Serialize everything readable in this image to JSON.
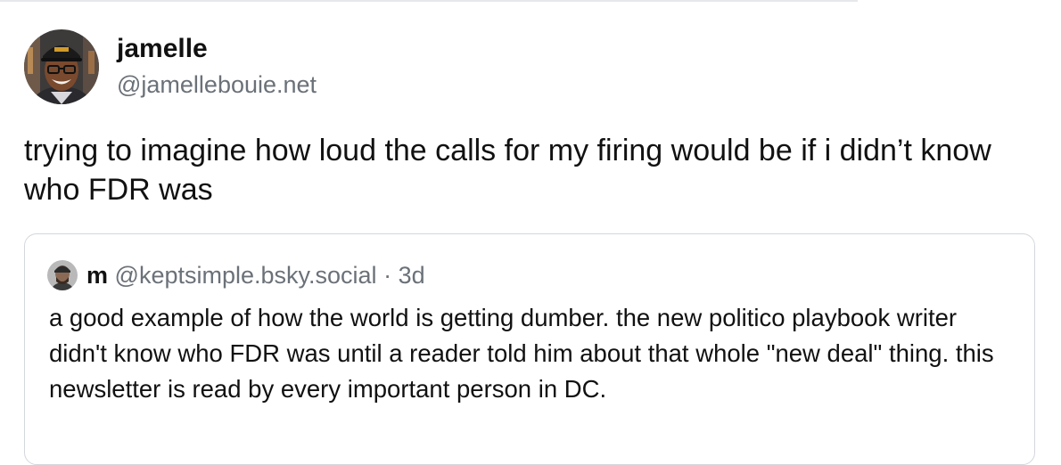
{
  "post": {
    "author": {
      "name": "jamelle",
      "handle": "@jamellebouie.net"
    },
    "text": "trying to imagine how loud the calls for my firing would be if i didn’t know who FDR was"
  },
  "quoted_post": {
    "author": {
      "name": "m",
      "handle": "@keptsimple.bsky.social"
    },
    "separator": "·",
    "timestamp": "3d",
    "text": "a good example of how the world is getting dumber. the new politico playbook writer didn't know who FDR was until a reader told him about that whole \"new deal\" thing.  this newsletter is read by every important person in DC."
  },
  "colors": {
    "text": "#111111",
    "muted": "#6b7178",
    "border": "#d4d7dc"
  }
}
